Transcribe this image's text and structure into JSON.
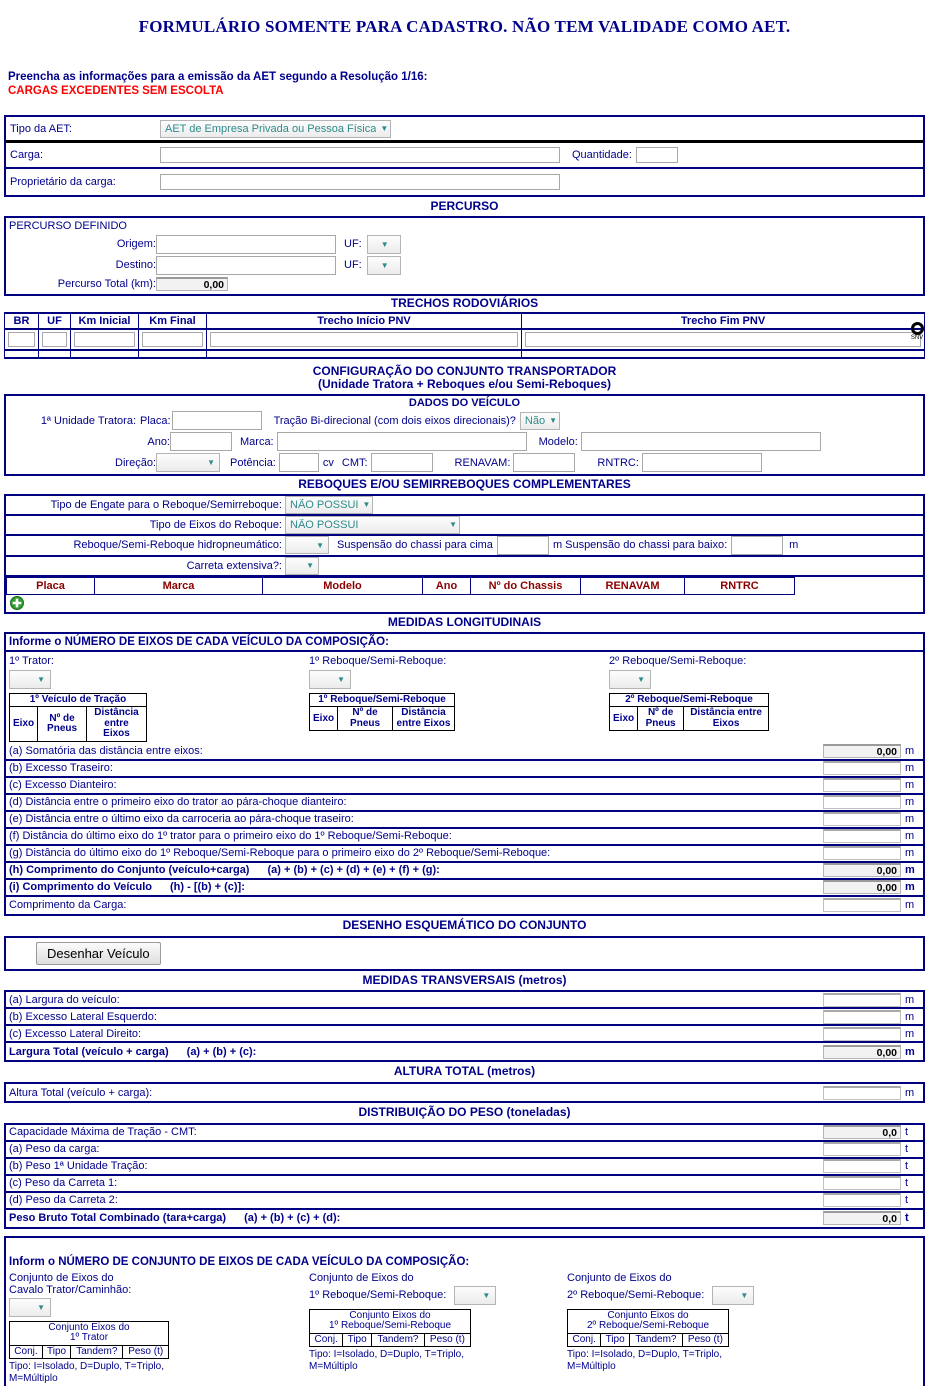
{
  "header": {
    "title": "FORMULÁRIO SOMENTE PARA CADASTRO. NÃO TEM VALIDADE COMO AET.",
    "instruction": "Preencha as informações para a emissão da AET segundo a Resolução 1/16:",
    "warning": "CARGAS EXCEDENTES SEM ESCOLTA"
  },
  "colors": {
    "navy": "#00008B",
    "border": "#000080",
    "red": "#ff0000",
    "dark_red": "#8B0000",
    "select_text": "#2e8b8b"
  },
  "aet": {
    "type_label": "Tipo da AET:",
    "type_value": "AET de Empresa Privada ou Pessoa Física",
    "carga_label": "Carga:",
    "carga_value": "",
    "quantidade_label": "Quantidade:",
    "quantidade_value": "",
    "proprietario_label": "Proprietário da carga:",
    "proprietario_value": ""
  },
  "percurso": {
    "section_title": "PERCURSO",
    "legend": "PERCURSO DEFINIDO",
    "origem_label": "Origem:",
    "origem_value": "",
    "origem_uf_label": "UF:",
    "origem_uf_value": "",
    "destino_label": "Destino:",
    "destino_value": "",
    "destino_uf_label": "UF:",
    "destino_uf_value": "",
    "total_label": "Percurso Total (km):",
    "total_value": "0,00",
    "trechos_title": "TRECHOS RODOVIÁRIOS",
    "trechos_headers": [
      "BR",
      "UF",
      "Km Inicial",
      "Km Final",
      "Trecho Início PNV",
      "Trecho Fim PNV"
    ],
    "snv_icon_caption": "SNV"
  },
  "configuracao": {
    "title_line1": "CONFIGURAÇÃO DO CONJUNTO TRANSPORTADOR",
    "title_line2": "(Unidade Tratora + Reboques e/ou Semi-Reboques)",
    "dados_title": "DADOS DO VEÍCULO",
    "unidade_label": "1ª Unidade Tratora:",
    "placa_label": "Placa:",
    "placa_value": "",
    "tracao_label": "Tração Bi-direcional (com dois eixos direcionais)?",
    "tracao_value": "Não",
    "ano_label": "Ano:",
    "ano_value": "",
    "marca_label": "Marca:",
    "marca_value": "",
    "modelo_label": "Modelo:",
    "modelo_value": "",
    "direcao_label": "Direção:",
    "direcao_value": "",
    "potencia_label": "Potência:",
    "potencia_value": "",
    "potencia_unit": "cv",
    "cmt_label": "CMT:",
    "cmt_value": "",
    "renavam_label": "RENAVAM:",
    "renavam_value": "",
    "rntrc_label": "RNTRC:",
    "rntrc_value": ""
  },
  "reboques": {
    "title": "REBOQUES E/OU SEMIRREBOQUES COMPLEMENTARES",
    "engate_label": "Tipo de Engate para o Reboque/Semirreboque:",
    "engate_value": "NÃO POSSUI",
    "eixos_label": "Tipo de Eixos do Reboque:",
    "eixos_value": "NÃO POSSUI",
    "hidro_label": "Reboque/Semi-Reboque hidropneumático:",
    "hidro_value": "",
    "susp_cima_label": "Suspensão do chassi para cima",
    "susp_cima_value": "",
    "susp_cima_unit": "m",
    "susp_baixo_label": "Suspensão do chassi para baixo:",
    "susp_baixo_value": "",
    "susp_baixo_unit": "m",
    "carreta_label": "Carreta extensiva?:",
    "carreta_value": "",
    "table_headers": [
      "Placa",
      "Marca",
      "Modelo",
      "Ano",
      "Nº do Chassis",
      "RENAVAM",
      "RNTRC"
    ],
    "add_icon": "plus-circle-icon"
  },
  "longitudinais": {
    "title": "MEDIDAS LONGITUDINAIS",
    "eixos_prompt": "Informe o NÚMERO DE EIXOS DE CADA VEÍCULO DA COMPOSIÇÃO:",
    "vehicles": [
      {
        "label": "1º Trator:",
        "count_value": "",
        "table_title": "1º Veículo de Tração",
        "headers": [
          "Eixo",
          "Nº de Pneus",
          "Distância entre Eixos"
        ]
      },
      {
        "label": "1º Reboque/Semi-Reboque:",
        "count_value": "",
        "table_title": "1º Reboque/Semi-Reboque",
        "headers": [
          "Eixo",
          "Nº de Pneus",
          "Distância entre Eixos"
        ]
      },
      {
        "label": "2º Reboque/Semi-Reboque:",
        "count_value": "",
        "table_title": "2º Reboque/Semi-Reboque",
        "headers": [
          "Eixo",
          "Nº de Pneus",
          "Distância entre Eixos"
        ]
      }
    ],
    "rows": [
      {
        "text": "(a) Somatória das distância entre eixos:",
        "formula": "",
        "value": "0,00",
        "unit": "m",
        "readonly": true,
        "bold": false
      },
      {
        "text": "(b) Excesso Traseiro:",
        "formula": "",
        "value": "",
        "unit": "m",
        "readonly": false,
        "bold": false
      },
      {
        "text": "(c) Excesso Dianteiro:",
        "formula": "",
        "value": "",
        "unit": "m",
        "readonly": false,
        "bold": false
      },
      {
        "text": "(d) Distância entre o primeiro eixo do trator ao pára-choque dianteiro:",
        "formula": "",
        "value": "",
        "unit": "m",
        "readonly": false,
        "bold": false
      },
      {
        "text": "(e) Distância entre o último eixo da carroceria ao pára-choque traseiro:",
        "formula": "",
        "value": "",
        "unit": "m",
        "readonly": false,
        "bold": false
      },
      {
        "text": "(f) Distância do último eixo do 1º trator para o primeiro eixo do 1º Reboque/Semi-Reboque:",
        "formula": "",
        "value": "",
        "unit": "m",
        "readonly": false,
        "bold": false
      },
      {
        "text": "(g) Distância do último eixo do 1º Reboque/Semi-Reboque para o primeiro eixo do 2º Reboque/Semi-Reboque:",
        "formula": "",
        "value": "",
        "unit": "m",
        "readonly": false,
        "bold": false
      },
      {
        "text": "(h) Comprimento do Conjunto (veículo+carga)",
        "formula": "(a) + (b) + (c) + (d) + (e) + (f) + (g):",
        "value": "0,00",
        "unit": "m",
        "readonly": true,
        "bold": true
      },
      {
        "text": "(i) Comprimento do Veículo",
        "formula": "(h) - [(b) + (c)]:",
        "value": "0,00",
        "unit": "m",
        "readonly": true,
        "bold": true
      },
      {
        "text": "Comprimento da Carga:",
        "formula": "",
        "value": "",
        "unit": "m",
        "readonly": false,
        "bold": false
      }
    ]
  },
  "desenho": {
    "title": "DESENHO ESQUEMÁTICO DO CONJUNTO",
    "button_label": "Desenhar Veículo"
  },
  "transversais": {
    "title": "MEDIDAS TRANSVERSAIS (metros)",
    "rows": [
      {
        "text": "(a) Largura do veículo:",
        "formula": "",
        "value": "",
        "unit": "m",
        "readonly": false,
        "bold": false
      },
      {
        "text": "(b) Excesso Lateral Esquerdo:",
        "formula": "",
        "value": "",
        "unit": "m",
        "readonly": false,
        "bold": false
      },
      {
        "text": "(c) Excesso Lateral Direito:",
        "formula": "",
        "value": "",
        "unit": "m",
        "readonly": false,
        "bold": false
      },
      {
        "text": "Largura Total (veículo + carga)",
        "formula": "(a) + (b) + (c):",
        "value": "0,00",
        "unit": "m",
        "readonly": true,
        "bold": true
      }
    ]
  },
  "altura": {
    "title": "ALTURA TOTAL (metros)",
    "rows": [
      {
        "text": "Altura Total (veículo + carga):",
        "formula": "",
        "value": "",
        "unit": "m",
        "readonly": false,
        "bold": false
      }
    ]
  },
  "peso": {
    "title": "DISTRIBUIÇÃO DO PESO (toneladas)",
    "rows": [
      {
        "text": "Capacidade Máxima de Tração - CMT:",
        "formula": "",
        "value": "0,0",
        "unit": "t",
        "readonly": true,
        "bold": false
      },
      {
        "text": "(a) Peso da carga:",
        "formula": "",
        "value": "",
        "unit": "t",
        "readonly": false,
        "bold": false
      },
      {
        "text": "(b) Peso 1ª Unidade Tração:",
        "formula": "",
        "value": "",
        "unit": "t",
        "readonly": false,
        "bold": false
      },
      {
        "text": "(c) Peso da Carreta 1:",
        "formula": "",
        "value": "",
        "unit": "t",
        "readonly": false,
        "bold": false
      },
      {
        "text": "(d) Peso da Carreta 2:",
        "formula": "",
        "value": "",
        "unit": "t",
        "readonly": false,
        "bold": false
      },
      {
        "text": "Peso Bruto Total Combinado (tara+carga)",
        "formula": "(a) + (b) + (c) + (d):",
        "value": "0,0",
        "unit": "t",
        "readonly": true,
        "bold": true
      }
    ]
  },
  "conjuntos": {
    "prompt": "Inform o NÚMERO DE CONJUNTO DE EIXOS DE CADA VEÍCULO DA COMPOSIÇÃO:",
    "groups": [
      {
        "label_line1": "Conjunto de Eixos do",
        "label_line2": "Cavalo Trator/Caminhão:",
        "count_value": "",
        "table_title_line1": "Conjunto Eixos do",
        "table_title_line2": "1º Trator",
        "headers": [
          "Conj.",
          "Tipo",
          "Tandem?",
          "Peso (t)"
        ],
        "note_line1": "Tipo: I=Isolado, D=Duplo, T=Triplo,",
        "note_line2": "M=Múltiplo"
      },
      {
        "label_line1": "Conjunto de Eixos do",
        "label_line2": "1º Reboque/Semi-Reboque:",
        "count_value": "",
        "table_title_line1": "Conjunto Eixos do",
        "table_title_line2": "1º Reboque/Semi-Reboque",
        "headers": [
          "Conj.",
          "Tipo",
          "Tandem?",
          "Peso (t)"
        ],
        "note_line1": "Tipo: I=Isolado, D=Duplo, T=Triplo,",
        "note_line2": "M=Múltiplo"
      },
      {
        "label_line1": "Conjunto de Eixos do",
        "label_line2": "2º Reboque/Semi-Reboque:",
        "count_value": "",
        "table_title_line1": "Conjunto Eixos do",
        "table_title_line2": "2º Reboque/Semi-Reboque",
        "headers": [
          "Conj.",
          "Tipo",
          "Tandem?",
          "Peso (t)"
        ],
        "note_line1": "Tipo: I=Isolado, D=Duplo, T=Triplo,",
        "note_line2": "M=Múltiplo"
      }
    ]
  }
}
